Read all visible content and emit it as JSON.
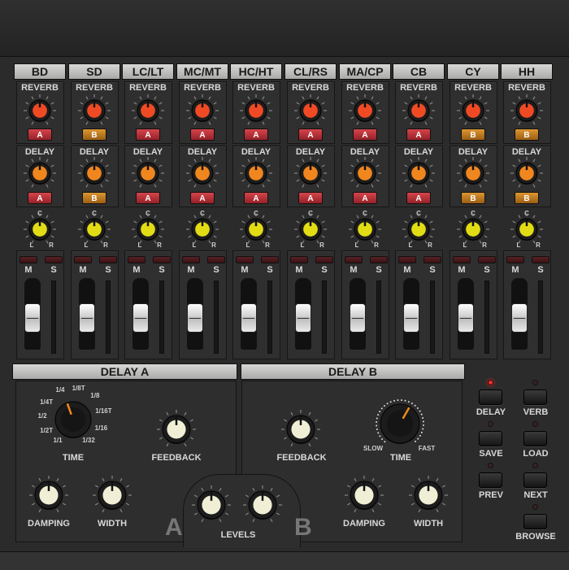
{
  "channels": [
    {
      "name": "BD",
      "reverb_send": "A",
      "delay_send": "A"
    },
    {
      "name": "SD",
      "reverb_send": "B",
      "delay_send": "B"
    },
    {
      "name": "LC/LT",
      "reverb_send": "A",
      "delay_send": "A"
    },
    {
      "name": "MC/MT",
      "reverb_send": "A",
      "delay_send": "A"
    },
    {
      "name": "HC/HT",
      "reverb_send": "A",
      "delay_send": "A"
    },
    {
      "name": "CL/RS",
      "reverb_send": "A",
      "delay_send": "A"
    },
    {
      "name": "MA/CP",
      "reverb_send": "A",
      "delay_send": "A"
    },
    {
      "name": "CB",
      "reverb_send": "A",
      "delay_send": "A"
    },
    {
      "name": "CY",
      "reverb_send": "B",
      "delay_send": "B"
    },
    {
      "name": "HH",
      "reverb_send": "B",
      "delay_send": "B"
    }
  ],
  "strip_labels": {
    "reverb": "REVERB",
    "delay": "DELAY",
    "pan_c": "C",
    "pan_l": "L",
    "pan_r": "R",
    "mute": "M",
    "solo": "S"
  },
  "fader_level": 0.65,
  "colors": {
    "reverb_knob": "#f04a24",
    "delay_knob": "#f0861e",
    "pan_knob": "#e2dc14",
    "send_a": "#c03a40",
    "send_b": "#cc8628",
    "cream_knob": "#f0efd6"
  },
  "delay_a": {
    "title": "DELAY A",
    "time_label": "TIME",
    "feedback_label": "FEEDBACK",
    "damping_label": "DAMPING",
    "width_label": "WIDTH",
    "letter": "A",
    "time_divisions": [
      "1/1",
      "1/2T",
      "1/2",
      "1/4T",
      "1/4",
      "1/8T",
      "1/8",
      "1/16T",
      "1/16",
      "1/32"
    ],
    "time_selected": "1/4"
  },
  "delay_b": {
    "title": "DELAY B",
    "time_label": "TIME",
    "feedback_label": "FEEDBACK",
    "damping_label": "DAMPING",
    "width_label": "WIDTH",
    "letter": "B",
    "slow_label": "SLOW",
    "fast_label": "FAST"
  },
  "levels_label": "LEVELS",
  "buttons": [
    {
      "label": "DELAY",
      "led": true
    },
    {
      "label": "VERB",
      "led": false
    },
    {
      "label": "SAVE",
      "led": false
    },
    {
      "label": "LOAD",
      "led": false
    },
    {
      "label": "PREV",
      "led": false
    },
    {
      "label": "NEXT",
      "led": false
    },
    {
      "label": "BROWSE",
      "led": false
    }
  ]
}
